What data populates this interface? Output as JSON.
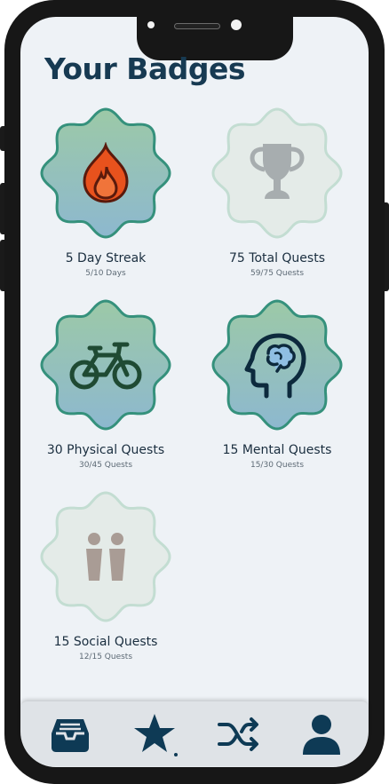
{
  "page": {
    "title": "Your Badges"
  },
  "badges": [
    {
      "name": "5 Day Streak",
      "progress": "5/10 Days",
      "icon": "flame-icon",
      "earned": true
    },
    {
      "name": "75 Total Quests",
      "progress": "59/75 Quests",
      "icon": "trophy-icon",
      "earned": false
    },
    {
      "name": "30 Physical Quests",
      "progress": "30/45 Quests",
      "icon": "bicycle-icon",
      "earned": true
    },
    {
      "name": "15 Mental Quests",
      "progress": "15/30 Quests",
      "icon": "brain-head-icon",
      "earned": true
    },
    {
      "name": "15 Social Quests",
      "progress": "12/15 Quests",
      "icon": "people-icon",
      "earned": false
    }
  ],
  "nav": {
    "items": [
      {
        "icon": "inbox-tray-icon"
      },
      {
        "icon": "star-icon",
        "active": true
      },
      {
        "icon": "shuffle-icon"
      },
      {
        "icon": "user-profile-icon"
      }
    ]
  },
  "colors": {
    "title": "#173a52",
    "earned_gradient_top": "#9cc9a7",
    "earned_gradient_bottom": "#8db8cf",
    "earned_border": "#35917c",
    "locked_fill": "#e4ebe8",
    "locked_border": "#c3ddd2",
    "nav_icon": "#0e3a55",
    "flame": "#e8521d"
  }
}
